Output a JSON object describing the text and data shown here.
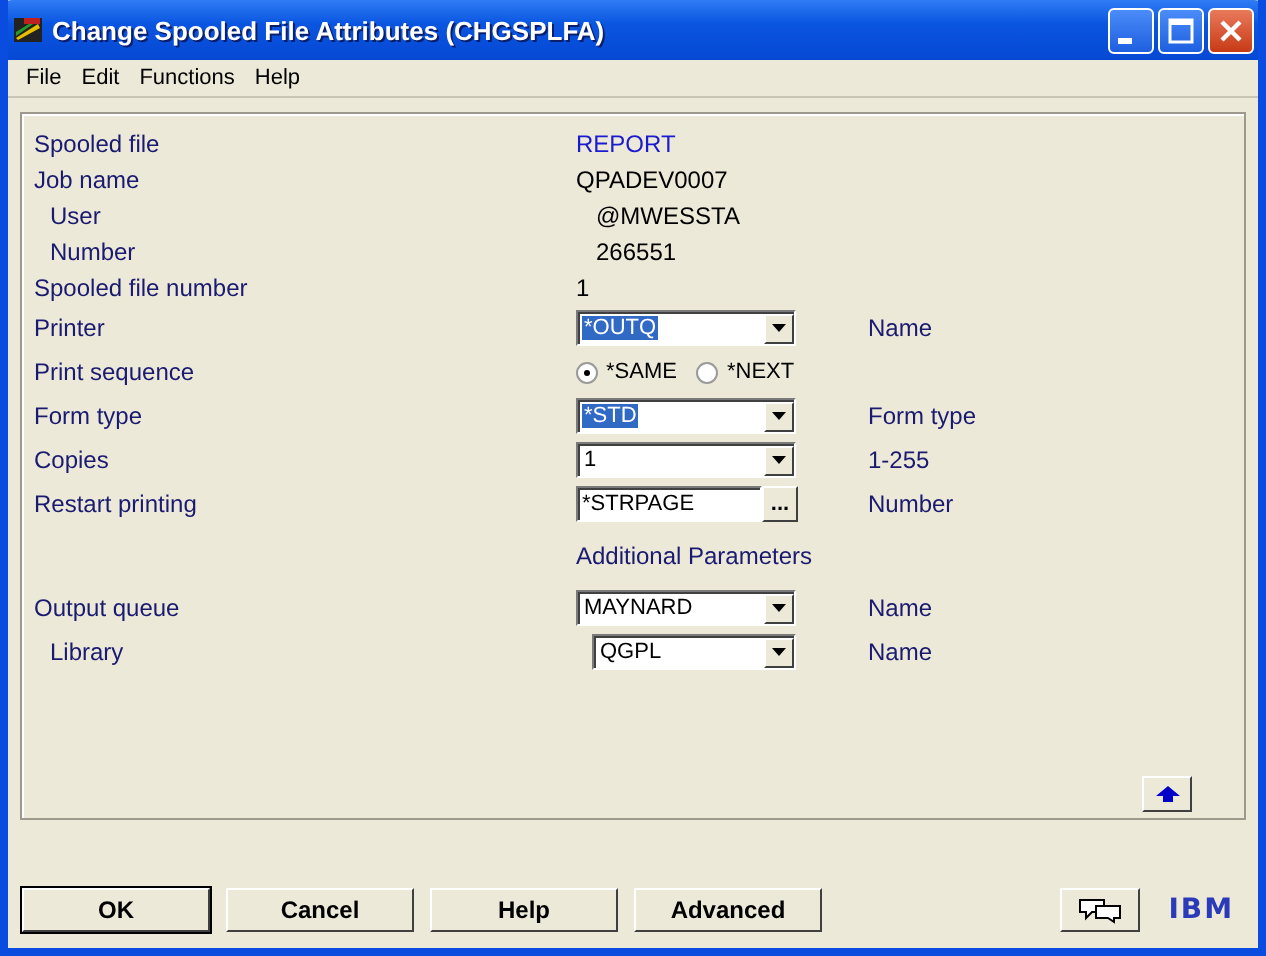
{
  "window": {
    "title": "Change Spooled File Attributes (CHGSPLFA)"
  },
  "menu": [
    "File",
    "Edit",
    "Functions",
    "Help"
  ],
  "rows": [
    {
      "kind": "text",
      "label": "Spooled file",
      "value": "REPORT",
      "emphasis": true
    },
    {
      "kind": "text",
      "label": "Job name",
      "value": "QPADEV0007",
      "emphasis": false,
      "children": [
        {
          "kind": "text",
          "label": "User",
          "value": "@MWESSTA",
          "emphasis": false
        },
        {
          "kind": "text",
          "label": "Number",
          "value": "266551",
          "emphasis": false
        }
      ]
    },
    {
      "kind": "text",
      "label": "Spooled file number",
      "value": "1",
      "emphasis": false
    },
    {
      "kind": "combo",
      "label": "Printer",
      "value": "*OUTQ",
      "selected": true,
      "hint": "Name"
    },
    {
      "kind": "radio",
      "label": "Print sequence",
      "options": [
        {
          "label": "*SAME",
          "selected": true
        },
        {
          "label": "*NEXT",
          "selected": false
        }
      ]
    },
    {
      "kind": "combo",
      "label": "Form type",
      "value": "*STD",
      "selected": true,
      "hint": "Form type"
    },
    {
      "kind": "combo",
      "label": "Copies",
      "value": "1",
      "selected": false,
      "hint": "1-255"
    },
    {
      "kind": "entry",
      "label": "Restart printing",
      "value": "*STRPAGE",
      "button": "...",
      "hint": "Number"
    }
  ],
  "additional": {
    "heading": "Additional Parameters",
    "rows": [
      {
        "kind": "combo",
        "label": "Output queue",
        "value": "MAYNARD",
        "selected": false,
        "hint": "Name",
        "children": [
          {
            "kind": "combo",
            "label": "Library",
            "value": "QGPL",
            "selected": false,
            "hint": "Name"
          }
        ]
      }
    ]
  },
  "buttons": [
    {
      "label": "OK",
      "default": true
    },
    {
      "label": "Cancel",
      "default": false
    },
    {
      "label": "Help",
      "default": false
    },
    {
      "label": "Advanced",
      "default": false
    }
  ],
  "logo": "IBM"
}
